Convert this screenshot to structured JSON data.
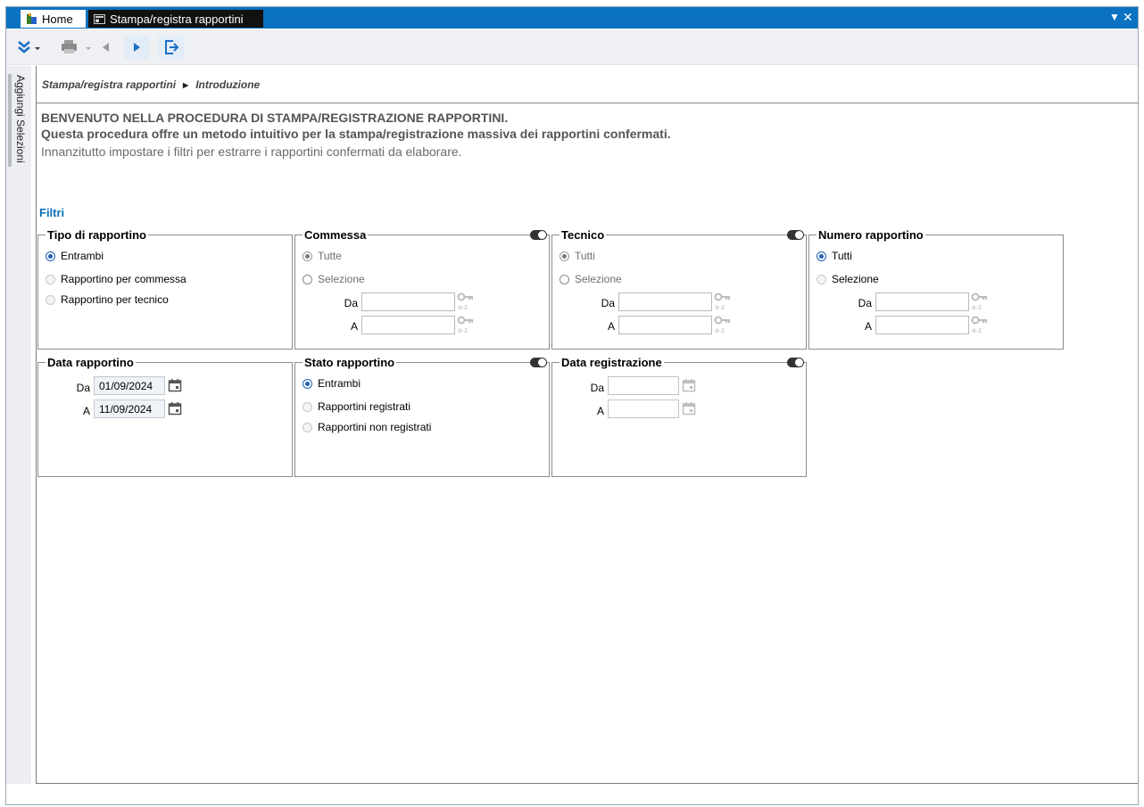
{
  "tabs": {
    "home": "Home",
    "active": "Stampa/registra rapportini"
  },
  "sidebar": {
    "label": "Aggiungi Selezioni"
  },
  "breadcrumb": {
    "root": "Stampa/registra rapportini",
    "current": "Introduzione"
  },
  "intro": {
    "line1": "BENVENUTO NELLA PROCEDURA DI STAMPA/REGISTRAZIONE RAPPORTINI.",
    "line2": "Questa procedura offre un metodo intuitivo per la stampa/registrazione massiva dei rapportini confermati.",
    "line3": "Innanzitutto impostare i filtri per estrarre i rapportini confermati da elaborare."
  },
  "filtri_label": "Filtri",
  "tipo": {
    "title": "Tipo di rapportino",
    "opt1": "Entrambi",
    "opt2": "Rapportino per commessa",
    "opt3": "Rapportino per tecnico"
  },
  "commessa": {
    "title": "Commessa",
    "opt1": "Tutte",
    "opt2": "Selezione",
    "da": "Da",
    "a": "A"
  },
  "tecnico": {
    "title": "Tecnico",
    "opt1": "Tutti",
    "opt2": "Selezione",
    "da": "Da",
    "a": "A"
  },
  "numero": {
    "title": "Numero rapportino",
    "opt1": "Tutti",
    "opt2": "Selezione",
    "da": "Da",
    "a": "A"
  },
  "data_rapportino": {
    "title": "Data rapportino",
    "da": "Da",
    "a": "A",
    "da_value": "01/09/2024",
    "a_value": "11/09/2024"
  },
  "stato": {
    "title": "Stato rapportino",
    "opt1": "Entrambi",
    "opt2": "Rapportini registrati",
    "opt3": "Rapportini non registrati"
  },
  "data_registrazione": {
    "title": "Data registrazione",
    "da": "Da",
    "a": "A",
    "da_value": "",
    "a_value": ""
  },
  "icons": {
    "key": "key-az-icon",
    "calendar": "calendar-icon"
  },
  "colors": {
    "accent": "#0a72c1",
    "filtri": "#0a6fb5",
    "radio": "#1d5fb3"
  }
}
